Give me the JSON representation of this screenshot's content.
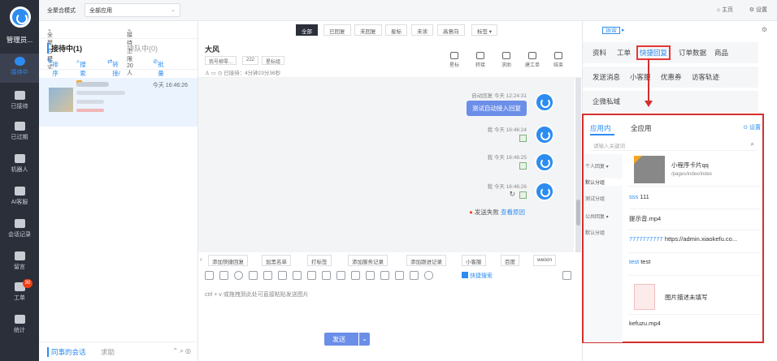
{
  "nav": {
    "org": "管理员...",
    "items": [
      {
        "label": "接待中",
        "icon": "chat-icon"
      },
      {
        "label": "已接待",
        "icon": "check-icon"
      },
      {
        "label": "已过期",
        "icon": "clock-icon"
      },
      {
        "label": "机器人",
        "icon": "robot-icon"
      },
      {
        "label": "AI客服",
        "icon": "ai-icon"
      },
      {
        "label": "会话记录",
        "icon": "record-icon"
      },
      {
        "label": "留言",
        "icon": "message-icon"
      },
      {
        "label": "工单",
        "icon": "ticket-icon",
        "badge": "30"
      },
      {
        "label": "统计",
        "icon": "stats-icon"
      }
    ]
  },
  "topbar": {
    "mode": "全聚合模式",
    "app_select": "全部应用",
    "home": "主页",
    "settings": "设置"
  },
  "list": {
    "filter_mode": "全聚合模式",
    "filter_limit": "接待上限20人",
    "tab_active": "接待中(1)",
    "tab_idle": "排队中(0)",
    "ops": [
      "排序",
      "搜索",
      "转接/接入",
      "批量结束"
    ],
    "session_time": "今天 16:46:26",
    "bottom_a": "同事的会话",
    "bottom_b": "求助"
  },
  "chat": {
    "filters": [
      "全部",
      "已回复",
      "未回复",
      "星标",
      "未读",
      "高意向",
      "标签"
    ],
    "contact_name": "大风",
    "pills": [
      "我号柳零...",
      "222",
      "星标组"
    ],
    "meta": "已接待：4分钟23分36秒",
    "head_icons": [
      "星标",
      "转接",
      "求助",
      "建工单",
      "结束"
    ],
    "messages": {
      "auto_label": "自动回复 今天 12:24:31",
      "bubble": "测试自动接入回复",
      "m1": "我 今天 16:46:24",
      "m2": "我 今天 16:46:25",
      "m3": "我 今天 16:46:26",
      "fail": "发送失败",
      "fail_link": "查看原因"
    },
    "quick": [
      "添加快捷回复",
      "加黑名单",
      "打标签",
      "添加服务记录",
      "添加跟进记录",
      "小客服",
      "百度",
      "weixin"
    ],
    "kefu_search": "快捷搜索",
    "hint": "ctrl + v 或拖拽到此处可直接粘贴发送图片",
    "send": "发送"
  },
  "right": {
    "sel_label": "运营",
    "tabs_row1": [
      "资料",
      "工单",
      "快捷回复",
      "订单数据",
      "商品"
    ],
    "tabs_row2": [
      "发送消息",
      "小客服",
      "优惠券",
      "访客轨迹"
    ],
    "tabs_row3": [
      "企微私域"
    ],
    "inner_tab_a": "应用内",
    "inner_tab_b": "全应用",
    "inner_settings": "设置",
    "search_placeholder": "请输入关键词",
    "cats": [
      "个人回复",
      "默认分组",
      "测试分组",
      "公共回复",
      "默认分组"
    ],
    "card_title": "小程序卡片qq",
    "card_path": "/pages/index/index",
    "sss_key": "sss",
    "sss_val": "111",
    "tip_file": "提示音.mp4",
    "num_key": "7777777777",
    "num_val": "https://admin.xiaokefu.co...",
    "test_key": "test",
    "test_val": "test",
    "img_desc": "图片描述未填写",
    "kefuzu": "kefuzu.mp4"
  }
}
